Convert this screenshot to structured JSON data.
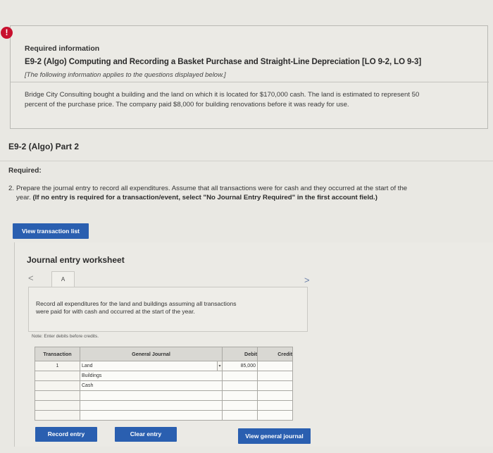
{
  "info": {
    "heading": "Required information",
    "title": "E9-2 (Algo) Computing and Recording a Basket Purchase and Straight-Line Depreciation [LO 9-2, LO 9-3]",
    "subtitle": "[The following information applies to the questions displayed below.]",
    "body": "Bridge City Consulting bought a building and the land on which it is located for $170,000 cash. The land is estimated to represent 50 percent of the purchase price. The company paid $8,000 for building renovations before it was ready for use."
  },
  "part": {
    "title": "E9-2 (Algo) Part 2",
    "required_label": "Required:",
    "question_number": "2.",
    "question_line1": "Prepare the journal entry to record all expenditures. Assume that all transactions were for cash and they occurred at the start of the",
    "question_line2_plain": "year.",
    "question_line2_bold": "(If no entry is required for a transaction/event, select \"No Journal Entry Required\" in the first account field.)"
  },
  "buttons": {
    "view_transaction_list": "View transaction list",
    "record_entry": "Record entry",
    "clear_entry": "Clear entry",
    "view_general_journal": "View general journal"
  },
  "worksheet": {
    "title": "Journal entry worksheet",
    "nav_prev": "<",
    "nav_next": ">",
    "tab_label": "A",
    "task_line1": "Record all expenditures for the land and buildings assuming all transactions",
    "task_line2": "were paid for with cash and occurred at the start of the year.",
    "note": "Note: Enter debits before credits."
  },
  "journal": {
    "headers": {
      "transaction": "Transaction",
      "general_journal": "General Journal",
      "debit": "Debit",
      "credit": "Credit"
    },
    "rows": [
      {
        "transaction": "1",
        "account": "Land",
        "debit": "85,000",
        "credit": ""
      },
      {
        "transaction": "",
        "account": "Buildings",
        "debit": "",
        "credit": ""
      },
      {
        "transaction": "",
        "account": "Cash",
        "debit": "",
        "credit": ""
      },
      {
        "transaction": "",
        "account": "",
        "debit": "",
        "credit": ""
      },
      {
        "transaction": "",
        "account": "",
        "debit": "",
        "credit": ""
      },
      {
        "transaction": "",
        "account": "",
        "debit": "",
        "credit": ""
      }
    ]
  },
  "icons": {
    "alert": "!",
    "dropdown": "▾"
  },
  "colors": {
    "button_blue": "#2a5fb0",
    "alert_red": "#c8102e"
  }
}
